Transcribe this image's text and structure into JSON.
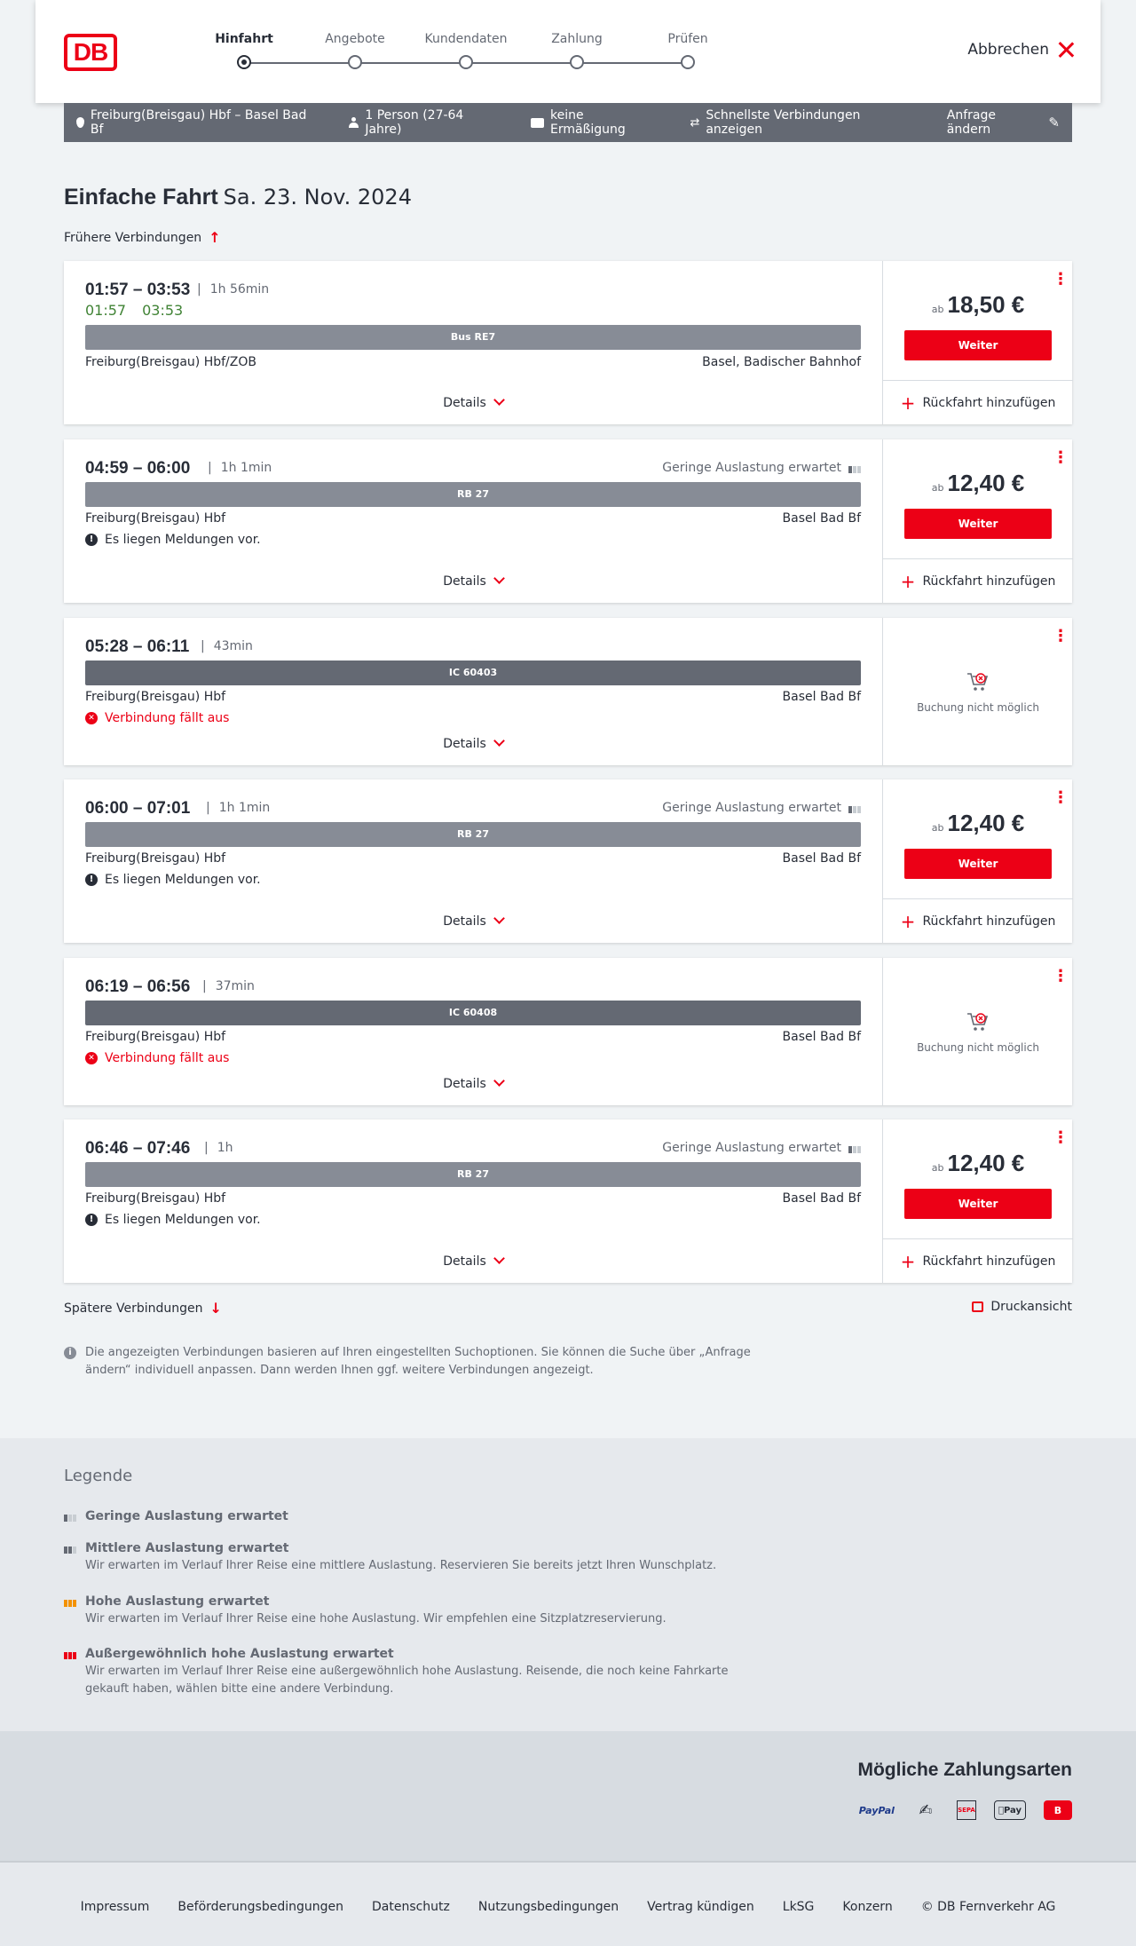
{
  "header": {
    "logo": "DB",
    "steps": [
      {
        "label": "Hinfahrt",
        "active": true
      },
      {
        "label": "Angebote",
        "active": false
      },
      {
        "label": "Kundendaten",
        "active": false
      },
      {
        "label": "Zahlung",
        "active": false
      },
      {
        "label": "Prüfen",
        "active": false
      }
    ],
    "cancel_label": "Abbrechen"
  },
  "query": {
    "route": "Freiburg(Breisgau) Hbf – Basel Bad Bf",
    "persons": "1 Person (27-64 Jahre)",
    "discount": "keine Ermäßigung",
    "fastest": "Schnellste Verbindungen anzeigen",
    "change": "Anfrage ändern"
  },
  "page": {
    "title": "Einfache Fahrt",
    "date": "Sa. 23. Nov. 2024",
    "earlier": "Frühere Verbindungen",
    "later": "Spätere Verbindungen",
    "print": "Druckansicht",
    "info": "Die angezeigten Verbindungen basieren auf Ihren eingestellten Suchoptionen. Sie können die Suche über „Anfrage ändern“ individuell anpassen. Dann werden Ihnen ggf. weitere Verbindungen angezeigt."
  },
  "labels": {
    "details": "Details",
    "weiter": "Weiter",
    "ab": "ab",
    "return": "Rückfahrt hinzufügen",
    "no_booking": "Buchung nicht möglich"
  },
  "connections": [
    {
      "times": "01:57 – 03:53",
      "duration": "1h 56min",
      "rt_dep": "01:57",
      "rt_arr": "03:53",
      "load": "",
      "train": "Bus RE7",
      "from": "Freiburg(Breisgau) Hbf/ZOB",
      "to": "Basel, Badischer Bahnhof",
      "message": "",
      "price": "18,50 €"
    },
    {
      "times": "04:59 – 06:00",
      "duration": "1h 1min",
      "load": "Geringe Auslastung erwartet",
      "train": "RB 27",
      "from": "Freiburg(Breisgau) Hbf",
      "to": "Basel Bad Bf",
      "message": "Es liegen Meldungen vor.",
      "price": "12,40 €"
    },
    {
      "times": "05:28 – 06:11",
      "duration": "43min",
      "load": "",
      "train": "IC 60403",
      "from": "Freiburg(Breisgau) Hbf",
      "to": "Basel Bad Bf",
      "message": "Verbindung fällt aus",
      "price": ""
    },
    {
      "times": "06:00 – 07:01",
      "duration": "1h 1min",
      "load": "Geringe Auslastung erwartet",
      "train": "RB 27",
      "from": "Freiburg(Breisgau) Hbf",
      "to": "Basel Bad Bf",
      "message": "Es liegen Meldungen vor.",
      "price": "12,40 €"
    },
    {
      "times": "06:19 – 06:56",
      "duration": "37min",
      "load": "",
      "train": "IC 60408",
      "from": "Freiburg(Breisgau) Hbf",
      "to": "Basel Bad Bf",
      "message": "Verbindung fällt aus",
      "price": ""
    },
    {
      "times": "06:46 – 07:46",
      "duration": "1h",
      "load": "Geringe Auslastung erwartet",
      "train": "RB 27",
      "from": "Freiburg(Breisgau) Hbf",
      "to": "Basel Bad Bf",
      "message": "Es liegen Meldungen vor.",
      "price": "12,40 €"
    }
  ],
  "legend": {
    "title": "Legende",
    "items": [
      {
        "title": "Geringe Auslastung erwartet",
        "text": "",
        "color": "#646973",
        "bars": 1
      },
      {
        "title": "Mittlere Auslastung erwartet",
        "text": "Wir erwarten im Verlauf Ihrer Reise eine mittlere Auslastung. Reservieren Sie bereits jetzt Ihren Wunschplatz.",
        "color": "#646973",
        "bars": 2
      },
      {
        "title": "Hohe Auslastung erwartet",
        "text": "Wir erwarten im Verlauf Ihrer Reise eine hohe Auslastung. Wir empfehlen eine Sitzplatzreservierung.",
        "color": "#f39200",
        "bars": 3
      },
      {
        "title": "Außergewöhnlich hohe Auslastung erwartet",
        "text": "Wir erwarten im Verlauf Ihrer Reise eine außergewöhnlich hohe Auslastung. Reisende, die noch keine Fahrkarte gekauft haben, wählen bitte eine andere Verbindung.",
        "color": "#ec0016",
        "bars": 3
      }
    ]
  },
  "payment": {
    "title": "Mögliche Zahlungsarten",
    "paypal": "PayPal",
    "sepa": "SEPA",
    "apple": "Pay",
    "db": "B"
  },
  "footer": {
    "links": [
      "Impressum",
      "Beförderungsbedingungen",
      "Datenschutz",
      "Nutzungsbedingungen",
      "Vertrag kündigen",
      "LkSG",
      "Konzern",
      "© DB Fernverkehr AG"
    ]
  },
  "colors": {
    "accent": "#ec0016",
    "realtime": "#408335",
    "bar": "#878c96",
    "bar_dark": "#646973"
  }
}
